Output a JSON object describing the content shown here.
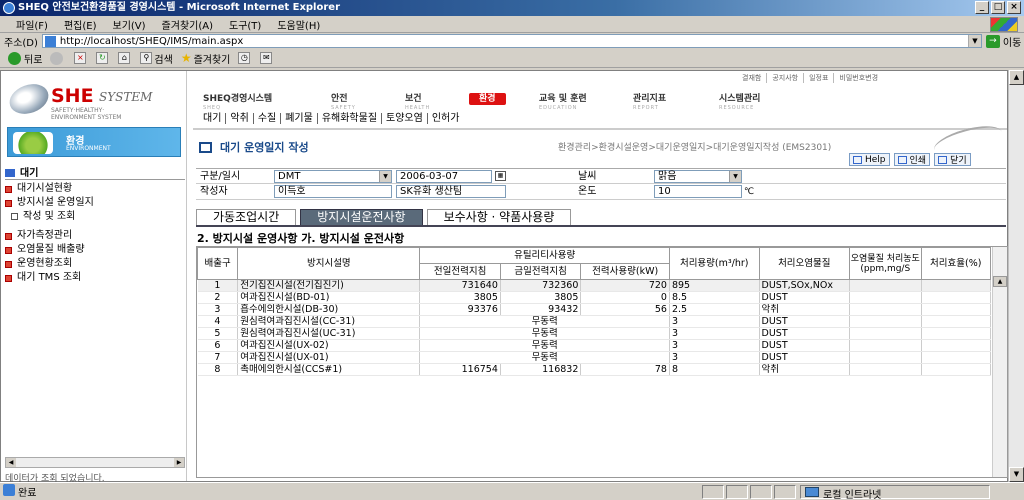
{
  "window": {
    "title": "SHEQ 안전보건환경품질 경영시스템 - Microsoft Internet Explorer"
  },
  "menu": [
    "파일(F)",
    "편집(E)",
    "보기(V)",
    "즐겨찾기(A)",
    "도구(T)",
    "도움말(H)"
  ],
  "address": {
    "label": "주소(D)",
    "url": "http://localhost/SHEQ/IMS/main.aspx",
    "go": "이동"
  },
  "toolbar": {
    "back": "뒤로",
    "search": "검색",
    "favorites": "즐겨찾기"
  },
  "logo": {
    "brand": "SHE",
    "system": "SYSTEM",
    "sub1": "SAFETY·HEALTHY·",
    "sub2": "ENVIRONMENT SYSTEM"
  },
  "banner": {
    "title": "환경",
    "subtitle": "ENVIRONMENT"
  },
  "sidebar": {
    "heading": "대기",
    "items": [
      "대기시설현황",
      "방지시설 운영일지"
    ],
    "sub": "작성 및 조회",
    "items2": [
      "자가측정관리",
      "오염물질 배출량",
      "운영현황조회",
      "대기 TMS 조회"
    ],
    "status": "데이터가 조회 되었습니다."
  },
  "utilnav": [
    "결재함",
    "공지사항",
    "일정표",
    "비밀번호변경"
  ],
  "mainnav": [
    {
      "label": "SHEQ경영시스템",
      "en": "SHEQ"
    },
    {
      "label": "안전",
      "en": "SAFETY"
    },
    {
      "label": "보건",
      "en": "HEALTH"
    },
    {
      "label": "환경",
      "en": ""
    },
    {
      "label": "교육 및 훈련",
      "en": "EDUCATION"
    },
    {
      "label": "관리지표",
      "en": "REPORT"
    },
    {
      "label": "시스템관리",
      "en": "RESOURCE"
    }
  ],
  "subnav": [
    "대기",
    "악취",
    "수질",
    "폐기물",
    "유해화학물질",
    "토양오염",
    "인허가"
  ],
  "page": {
    "title": "대기 운영일지 작성",
    "breadcrumb": "환경관리>환경시설운영>대기운영일지>대기운영일지작성 (EMS2301)"
  },
  "actions": {
    "help": "Help",
    "print": "인쇄",
    "close": "닫기"
  },
  "form": {
    "type_label": "구분/일시",
    "type_value": "DMT",
    "date_value": "2006-03-07",
    "weather_label": "날씨",
    "weather_value": "맑음",
    "writer_label": "작성자",
    "writer_value": "이득호",
    "dept_value": "SK유화 생산팀",
    "temp_label": "온도",
    "temp_value": "10",
    "temp_unit": "℃"
  },
  "tabs": [
    "가동조업시간",
    "방지시설운전사항",
    "보수사항 · 약품사용량"
  ],
  "section_title": "2. 방지시설 운영사항 가. 방지시설 운전사항",
  "table": {
    "h_no": "배출구",
    "h_name": "방지시설명",
    "h_utility": "유틸리티사용량",
    "h_prev": "전일전력지침",
    "h_today": "금일전력지침",
    "h_usage": "전력사용량(kW)",
    "h_flow": "처리용량(m³/hr)",
    "h_pollutant": "처리오염물질",
    "h_conc": "오염물질 처리농도(ppm,mg/S",
    "h_eff": "처리효율(%)",
    "rows": [
      {
        "no": "1",
        "name": "전기집진시설(전기집진기)",
        "prev": "731640",
        "today": "732360",
        "usage": "720",
        "flow": "895",
        "pollutant": "DUST,SOx,NOx"
      },
      {
        "no": "2",
        "name": "여과집진시설(BD-01)",
        "prev": "3805",
        "today": "3805",
        "usage": "0",
        "flow": "8.5",
        "pollutant": "DUST"
      },
      {
        "no": "3",
        "name": "흡수에의한시설(DB-30)",
        "prev": "93376",
        "today": "93432",
        "usage": "56",
        "flow": "2.5",
        "pollutant": "악취"
      },
      {
        "no": "4",
        "name": "원심력여과집진시설(CC-31)",
        "merged": "무동력",
        "flow": "3",
        "pollutant": "DUST"
      },
      {
        "no": "5",
        "name": "원심력여과집진시설(UC-31)",
        "merged": "무동력",
        "flow": "3",
        "pollutant": "DUST"
      },
      {
        "no": "6",
        "name": "여과집진시설(UX-02)",
        "merged": "무동력",
        "flow": "3",
        "pollutant": "DUST"
      },
      {
        "no": "7",
        "name": "여과집진시설(UX-01)",
        "merged": "무동력",
        "flow": "3",
        "pollutant": "DUST"
      },
      {
        "no": "8",
        "name": "촉매에의한시설(CCS#1)",
        "prev": "116754",
        "today": "116832",
        "usage": "78",
        "flow": "8",
        "pollutant": "악취"
      }
    ]
  },
  "statusbar": {
    "done": "완료",
    "zone": "로컬 인트라넷"
  }
}
